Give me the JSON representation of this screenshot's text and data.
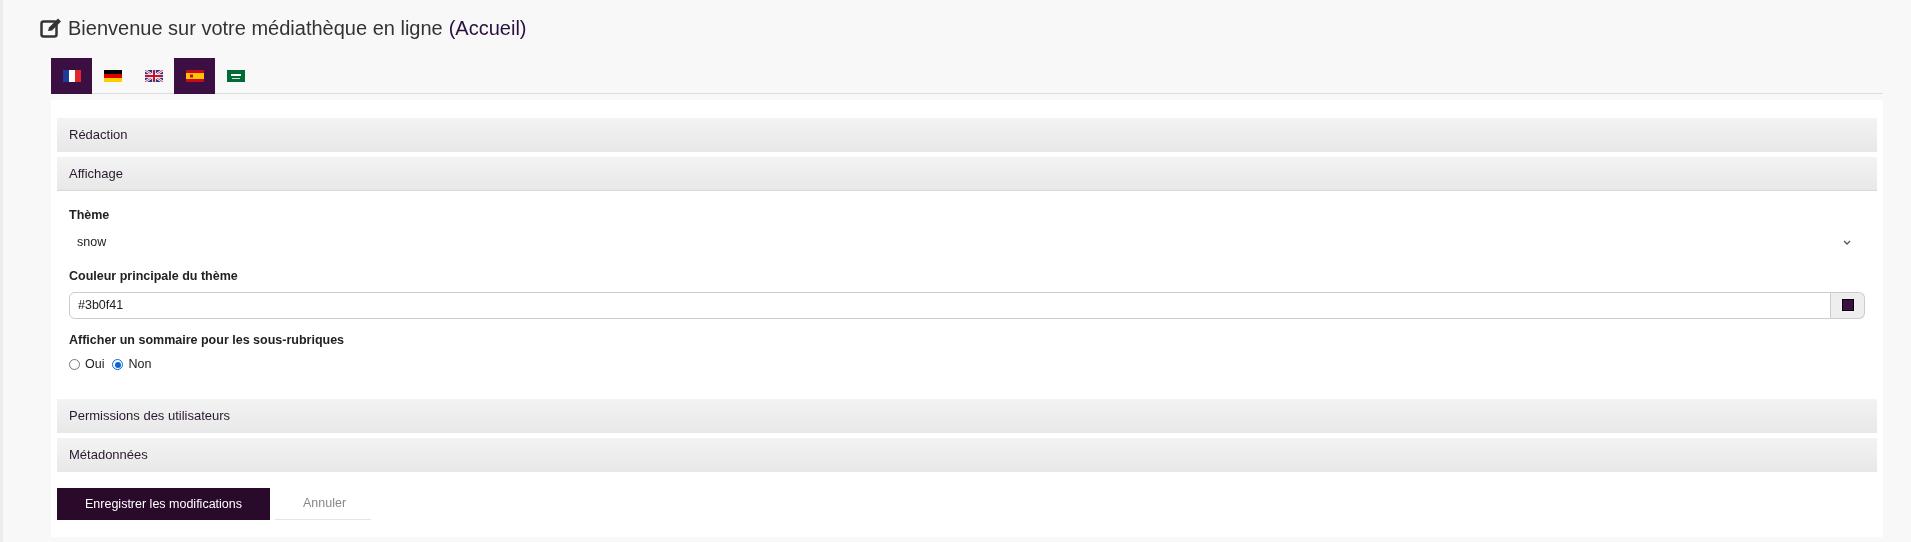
{
  "page_title": {
    "text": "Bienvenue sur votre médiathèque en ligne",
    "suffix": "(Accueil)"
  },
  "languages": [
    {
      "kind": "fr",
      "selected": true
    },
    {
      "kind": "de",
      "selected": false
    },
    {
      "kind": "gb",
      "selected": false
    },
    {
      "kind": "es",
      "selected": true
    },
    {
      "kind": "sa",
      "selected": false
    }
  ],
  "sections": [
    {
      "title": "Rédaction",
      "expanded": false
    },
    {
      "title": "Affichage",
      "expanded": true,
      "fields": [
        {
          "kind": "select",
          "label": "Thème",
          "value": "snow"
        },
        {
          "kind": "color",
          "label": "Couleur principale du thème",
          "value": "#3b0f41",
          "color": "#3b0f41"
        },
        {
          "kind": "radio",
          "label": "Afficher un sommaire pour les sous-rubriques",
          "options": [
            {
              "label": "Oui",
              "selected": false
            },
            {
              "label": "Non",
              "selected": true
            }
          ]
        }
      ]
    },
    {
      "title": "Permissions des utilisateurs",
      "expanded": false
    },
    {
      "title": "Métadonnées",
      "expanded": false
    }
  ],
  "buttons": [
    {
      "kind": "primary",
      "label": "Enregistrer les modifications"
    },
    {
      "kind": "secondary",
      "label": "Annuler"
    }
  ]
}
